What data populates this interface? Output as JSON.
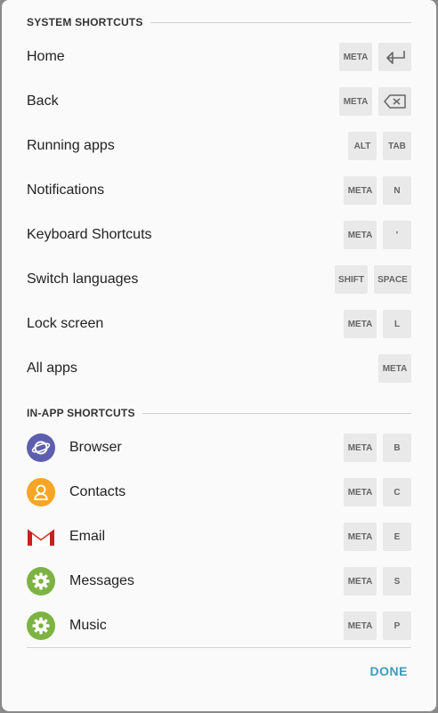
{
  "system_section": {
    "title": "SYSTEM SHORTCUTS"
  },
  "system_shortcuts": [
    {
      "label": "Home",
      "keys": [
        "META",
        "enter-icon"
      ]
    },
    {
      "label": "Back",
      "keys": [
        "META",
        "backspace-icon"
      ]
    },
    {
      "label": "Running apps",
      "keys": [
        "ALT",
        "TAB"
      ]
    },
    {
      "label": "Notifications",
      "keys": [
        "META",
        "N"
      ]
    },
    {
      "label": "Keyboard Shortcuts",
      "keys": [
        "META",
        "'"
      ]
    },
    {
      "label": "Switch languages",
      "keys": [
        "SHIFT",
        "SPACE"
      ]
    },
    {
      "label": "Lock screen",
      "keys": [
        "META",
        "L"
      ]
    },
    {
      "label": "All apps",
      "keys": [
        "META"
      ]
    }
  ],
  "inapp_section": {
    "title": "IN-APP SHORTCUTS"
  },
  "inapp_shortcuts": [
    {
      "label": "Browser",
      "icon": "browser-icon",
      "icon_color": "#5d5fae",
      "keys": [
        "META",
        "B"
      ]
    },
    {
      "label": "Contacts",
      "icon": "contacts-icon",
      "icon_color": "#f5a623",
      "keys": [
        "META",
        "C"
      ]
    },
    {
      "label": "Email",
      "icon": "gmail-icon",
      "icon_color": "#d93025",
      "keys": [
        "META",
        "E"
      ]
    },
    {
      "label": "Messages",
      "icon": "settings-gear-icon",
      "icon_color": "#7cb342",
      "keys": [
        "META",
        "S"
      ]
    },
    {
      "label": "Music",
      "icon": "settings-gear-icon",
      "icon_color": "#7cb342",
      "keys": [
        "META",
        "P"
      ]
    }
  ],
  "footer": {
    "done_label": "DONE",
    "done_color": "#3c9bc0"
  }
}
